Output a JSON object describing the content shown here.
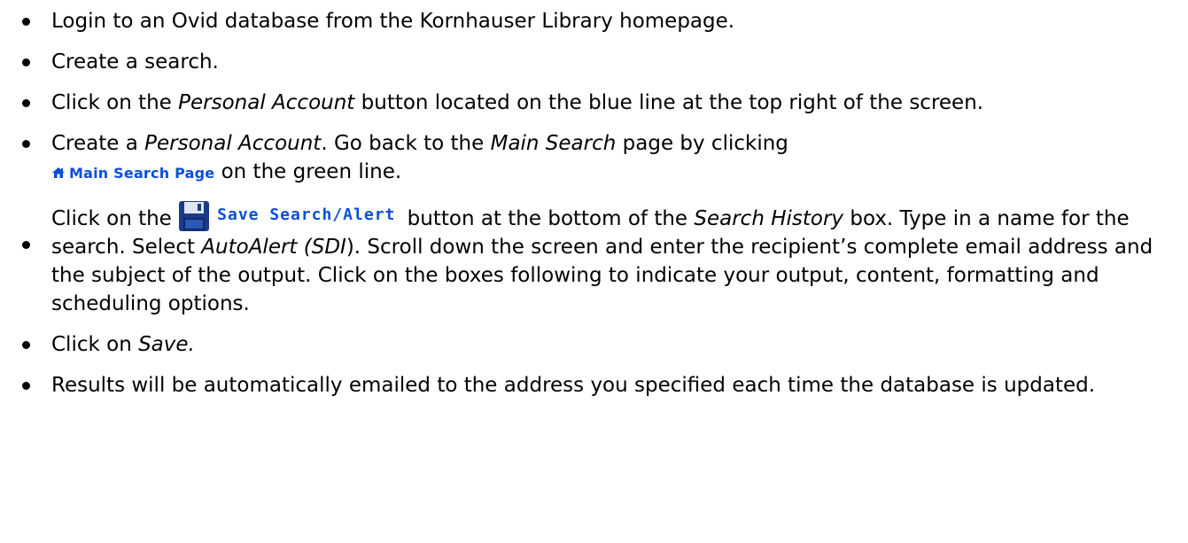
{
  "steps": [
    {
      "text": "Login to an Ovid database from the Kornhauser Library homepage."
    },
    {
      "text": "Create a search."
    },
    {
      "a": "Click on the ",
      "em1": "Personal Account",
      "b": " button located on the blue line at the top right of the screen."
    },
    {
      "a": "Create a ",
      "em1": "Personal Account",
      "b": ".  Go back to the ",
      "em2": "Main Search",
      "c": " page by clicking ",
      "img_label": "Main Search Page",
      "d": " on the green line."
    },
    {
      "a": "Click on the ",
      "img_label": "Save Search/Alert",
      "b": " button at the bottom of the ",
      "em1": "Search History",
      "c": " box.  Type in a name for the search. Select ",
      "em2": "AutoAlert (SDI",
      "d": ").  Scroll down the screen and enter the recipient’s complete email address and the subject of the output.  Click on the boxes following to indicate your output, content, formatting  and scheduling options."
    },
    {
      "a": "Click on ",
      "em1": "Save."
    },
    {
      "text": "Results will be automatically emailed to the address you specified each time the database is updated."
    }
  ],
  "colors": {
    "text": "#000000",
    "link_blue": "#0a4fd8",
    "icon_navy": "#1b3b8a"
  },
  "icons": {
    "home": "home-icon",
    "save": "floppy-disk-icon"
  }
}
